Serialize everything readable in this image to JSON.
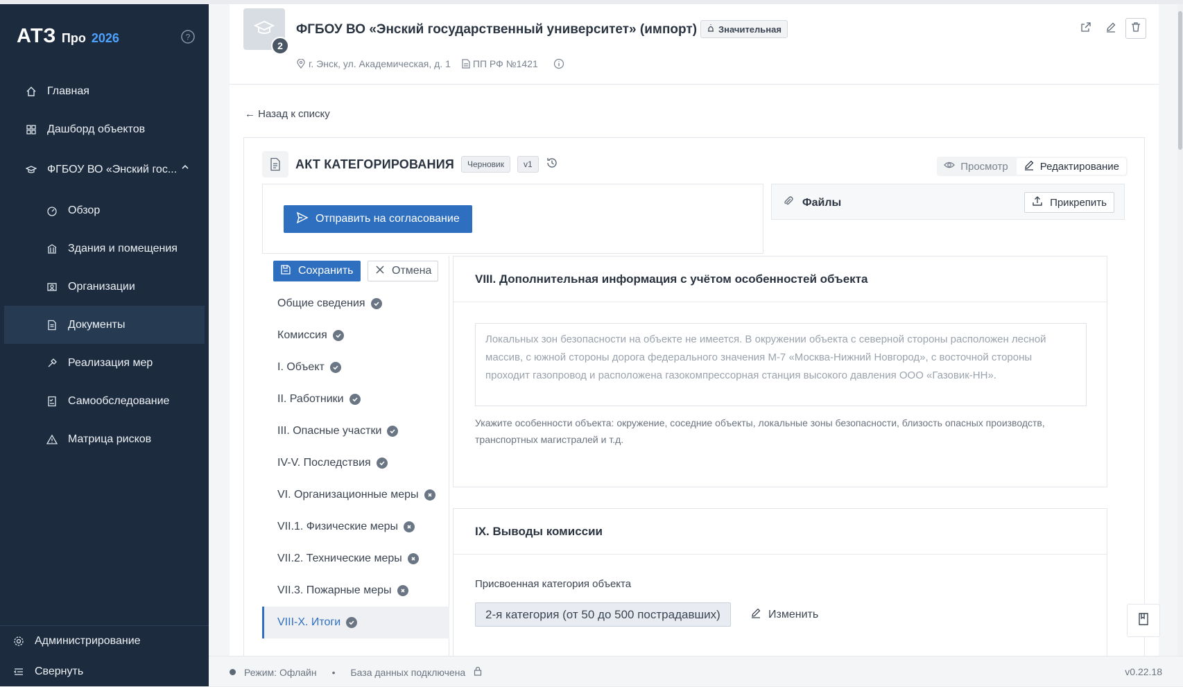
{
  "sidebar": {
    "brand": {
      "logo": "АТЗ",
      "pro": "Про",
      "year": "2026"
    },
    "items": [
      {
        "label": "Главная",
        "icon": "home-icon"
      },
      {
        "label": "Дашборд объектов",
        "icon": "grid-icon"
      },
      {
        "label": "ФГБОУ ВО «Энский гос...",
        "icon": "graduation-cap-icon"
      },
      {
        "label": "Обзор",
        "icon": "gauge-icon"
      },
      {
        "label": "Здания и помещения",
        "icon": "building-icon"
      },
      {
        "label": "Организации",
        "icon": "id-card-icon"
      },
      {
        "label": "Документы",
        "icon": "document-icon"
      },
      {
        "label": "Реализация мер",
        "icon": "tools-icon"
      },
      {
        "label": "Самообследование",
        "icon": "checklist-icon"
      },
      {
        "label": "Матрица рисков",
        "icon": "warning-icon"
      }
    ],
    "bottom": [
      {
        "label": "Администрирование",
        "icon": "gear-icon"
      },
      {
        "label": "Свернуть",
        "icon": "collapse-icon"
      }
    ]
  },
  "header": {
    "badge_count": "2",
    "title": "ФГБОУ ВО «Энский государственный университет» (импорт)",
    "significance": "Значительная",
    "address": "г. Энск, ул. Академическая, д. 1",
    "regulation": "ПП РФ №1421"
  },
  "back_link": "← Назад к списку",
  "doc": {
    "title": "АКТ КАТЕГОРИРОВАНИЯ",
    "status": "Черновик",
    "version": "v1",
    "mode_view": "Просмотр",
    "mode_edit": "Редактирование",
    "send_label": "Отправить на согласование",
    "files_label": "Файлы",
    "attach_label": "Прикрепить",
    "save_label": "Сохранить",
    "cancel_label": "Отмена"
  },
  "sections": [
    {
      "label": "Общие сведения",
      "status": "done"
    },
    {
      "label": "Комиссия",
      "status": "done"
    },
    {
      "label": "I. Объект",
      "status": "done"
    },
    {
      "label": "II. Работники",
      "status": "done"
    },
    {
      "label": "III. Опасные участки",
      "status": "done"
    },
    {
      "label": "IV-V. Последствия",
      "status": "done"
    },
    {
      "label": "VI. Организационные меры",
      "status": "incomplete"
    },
    {
      "label": "VII.1. Физические меры",
      "status": "incomplete"
    },
    {
      "label": "VII.2. Технические меры",
      "status": "incomplete"
    },
    {
      "label": "VII.3. Пожарные меры",
      "status": "incomplete"
    },
    {
      "label": "VIII-X. Итоги",
      "status": "done"
    }
  ],
  "section8": {
    "title": "VIII. Дополнительная информация с учётом особенностей объекта",
    "text": "Локальных зон безопасности на объекте не имеется. В окружении объекта с северной стороны расположен лесной массив, с южной стороны дорога федерального значения М-7 «Москва-Нижний Новгород», с восточной стороны проходит газопровод и расположена газокомпрессорная станция высокого давления ООО «Газовик-НН».",
    "hint": "Укажите особенности объекта: окружение, соседние объекты, локальные зоны безопасности, близость опасных производств, транспортных магистралей и т.д."
  },
  "section9": {
    "title": "IX. Выводы комиссии",
    "field_label": "Присвоенная категория объекта",
    "category_value": "2-я категория (от 50 до 500 пострадавших)",
    "change_label": "Изменить"
  },
  "status_bar": {
    "mode": "Режим: Офлайн",
    "db": "База данных подключена",
    "version": "v0.22.18"
  },
  "colors": {
    "sidebar_bg": "#1c2b3e",
    "accent": "#2e6fbf",
    "year": "#4da3ff"
  }
}
